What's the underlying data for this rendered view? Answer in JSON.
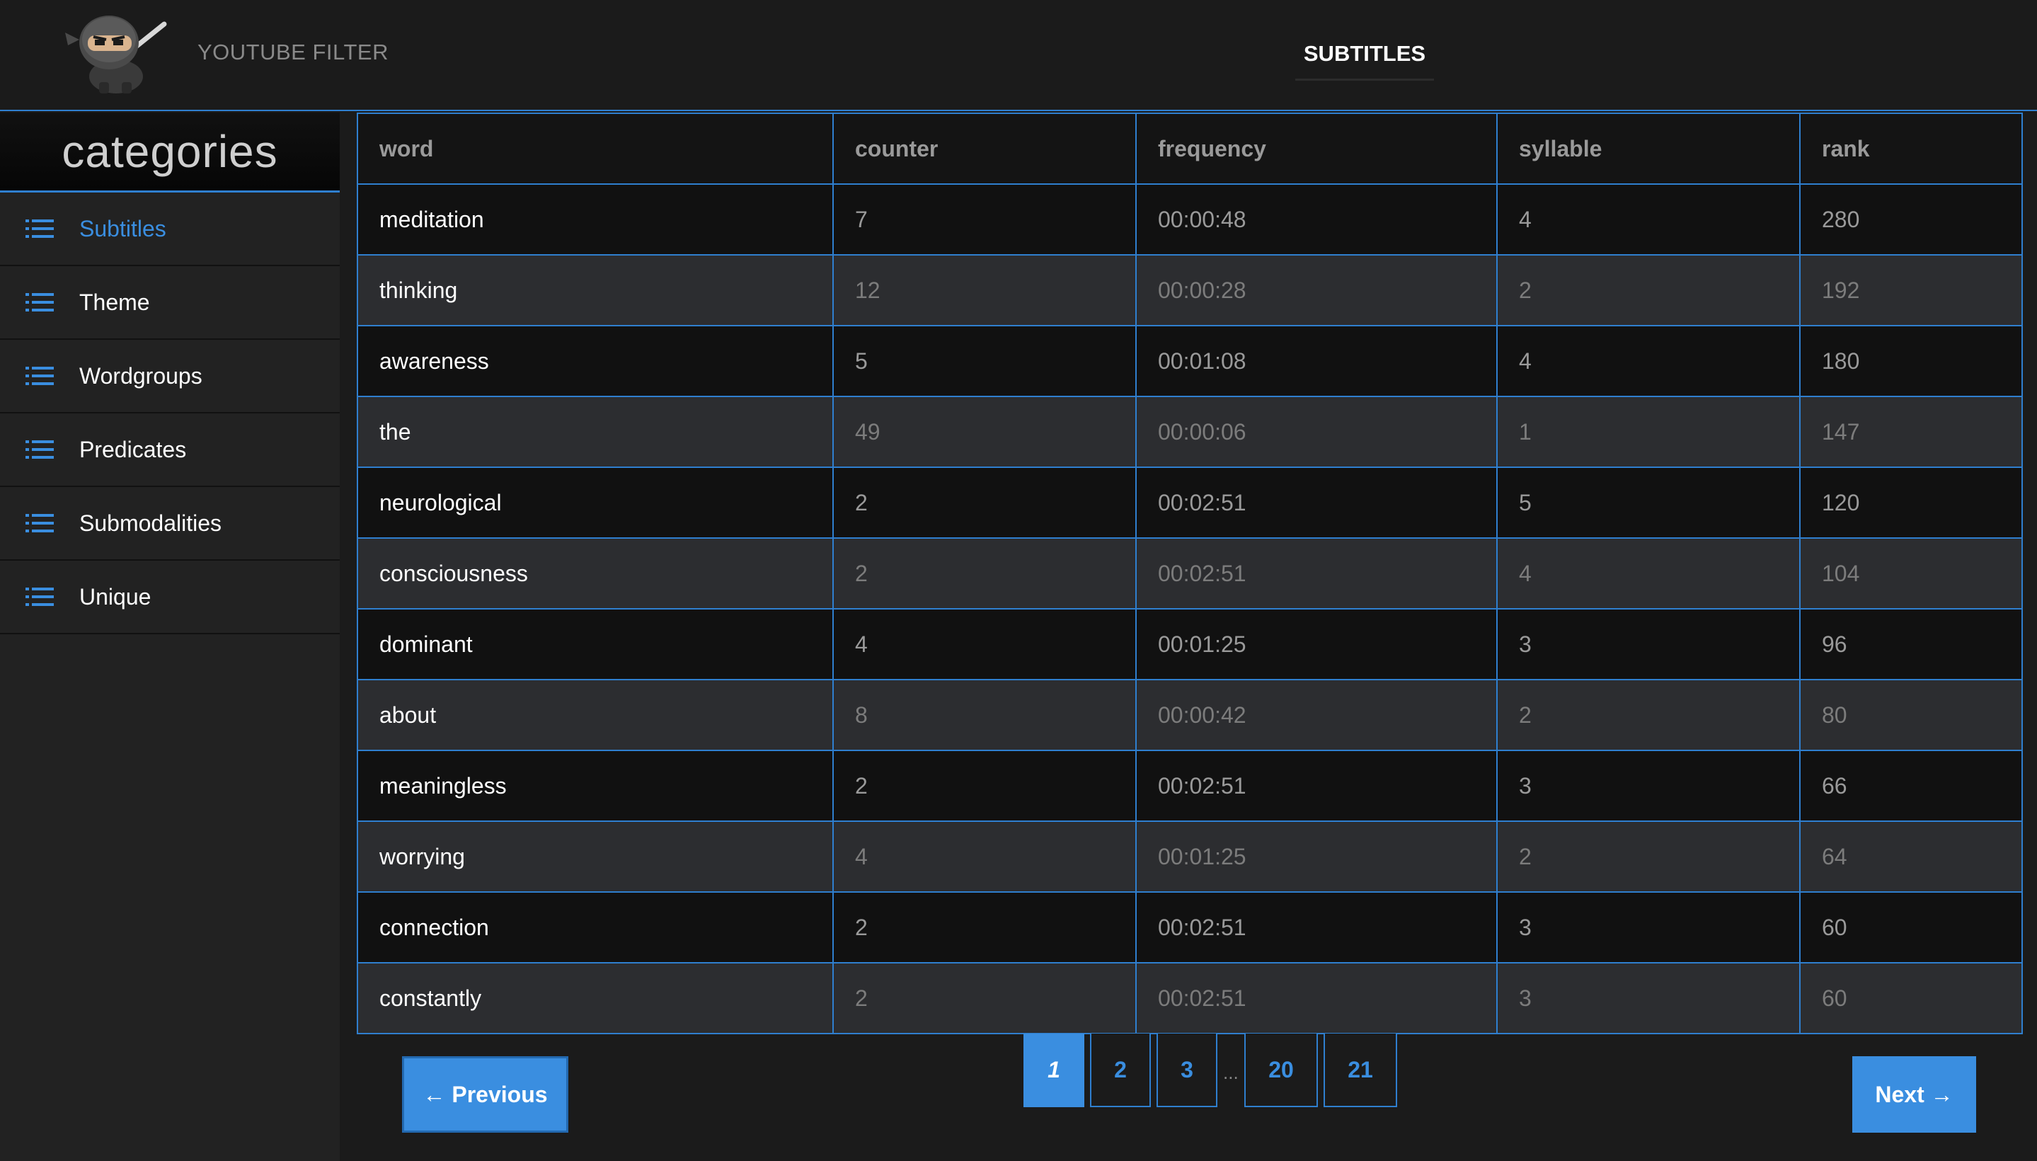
{
  "header": {
    "app_title": "YOUTUBE FILTER",
    "active_tab": "SUBTITLES"
  },
  "sidebar": {
    "heading": "categories",
    "items": [
      {
        "label": "Subtitles",
        "active": true
      },
      {
        "label": "Theme",
        "active": false
      },
      {
        "label": "Wordgroups",
        "active": false
      },
      {
        "label": "Predicates",
        "active": false
      },
      {
        "label": "Submodalities",
        "active": false
      },
      {
        "label": "Unique",
        "active": false
      }
    ]
  },
  "table": {
    "columns": [
      "word",
      "counter",
      "frequency",
      "syllable",
      "rank"
    ],
    "rows": [
      [
        "meditation",
        "7",
        "00:00:48",
        "4",
        "280"
      ],
      [
        "thinking",
        "12",
        "00:00:28",
        "2",
        "192"
      ],
      [
        "awareness",
        "5",
        "00:01:08",
        "4",
        "180"
      ],
      [
        "the",
        "49",
        "00:00:06",
        "1",
        "147"
      ],
      [
        "neurological",
        "2",
        "00:02:51",
        "5",
        "120"
      ],
      [
        "consciousness",
        "2",
        "00:02:51",
        "4",
        "104"
      ],
      [
        "dominant",
        "4",
        "00:01:25",
        "3",
        "96"
      ],
      [
        "about",
        "8",
        "00:00:42",
        "2",
        "80"
      ],
      [
        "meaningless",
        "2",
        "00:02:51",
        "3",
        "66"
      ],
      [
        "worrying",
        "4",
        "00:01:25",
        "2",
        "64"
      ],
      [
        "connection",
        "2",
        "00:02:51",
        "3",
        "60"
      ],
      [
        "constantly",
        "2",
        "00:02:51",
        "3",
        "60"
      ]
    ]
  },
  "pagination": {
    "previous_label": "← Previous",
    "next_label": "Next →",
    "pages": [
      "1",
      "2",
      "3",
      "20",
      "21"
    ],
    "current_page": "1",
    "ellipsis": "..."
  },
  "colors": {
    "accent": "#3a8ee0",
    "border": "#2f7fcf",
    "background": "#1b1b1b"
  },
  "icons": {
    "logo": "ninja-logo",
    "sidebar_item": "list-icon"
  }
}
